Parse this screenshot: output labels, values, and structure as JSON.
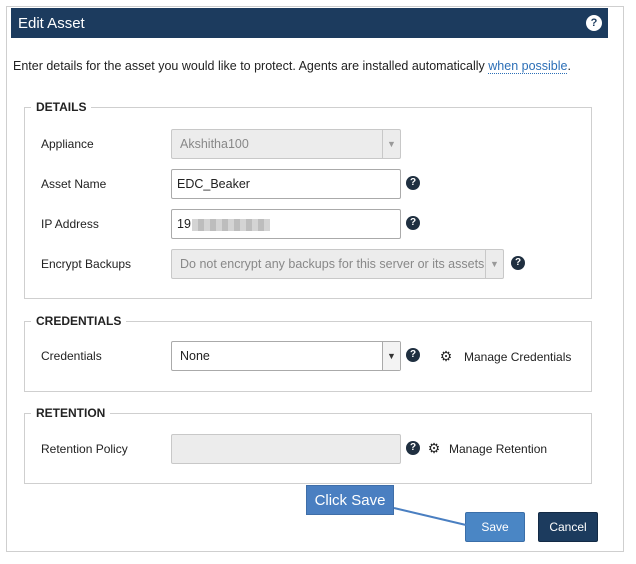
{
  "dialog": {
    "title": "Edit Asset",
    "intro_text": "Enter details for the asset you would like to protect. Agents are installed automatically ",
    "intro_link": "when possible",
    "intro_tail": "."
  },
  "details": {
    "legend": "DETAILS",
    "appliance_label": "Appliance",
    "appliance_value": "Akshitha100",
    "asset_name_label": "Asset Name",
    "asset_name_value": "EDC_Beaker",
    "ip_label": "IP Address",
    "ip_value_visible": "19",
    "encrypt_label": "Encrypt Backups",
    "encrypt_value": "Do not encrypt any backups for this server or its assets"
  },
  "credentials": {
    "legend": "CREDENTIALS",
    "label": "Credentials",
    "value": "None",
    "manage_label": "Manage Credentials"
  },
  "retention": {
    "legend": "RETENTION",
    "label": "Retention Policy",
    "value": "",
    "manage_label": "Manage Retention"
  },
  "buttons": {
    "save": "Save",
    "cancel": "Cancel"
  },
  "annotation": {
    "callout_text": "Click Save"
  },
  "icons": {
    "help": "help-icon",
    "gear": "gear-icon",
    "dropdown": "chevron-down-icon"
  },
  "colors": {
    "header_bg": "#1c3b5e",
    "save_bg": "#4a86c5",
    "cancel_bg": "#1c3b5e",
    "link": "#2c6fb7",
    "callout_bg": "#4a7fc1"
  }
}
